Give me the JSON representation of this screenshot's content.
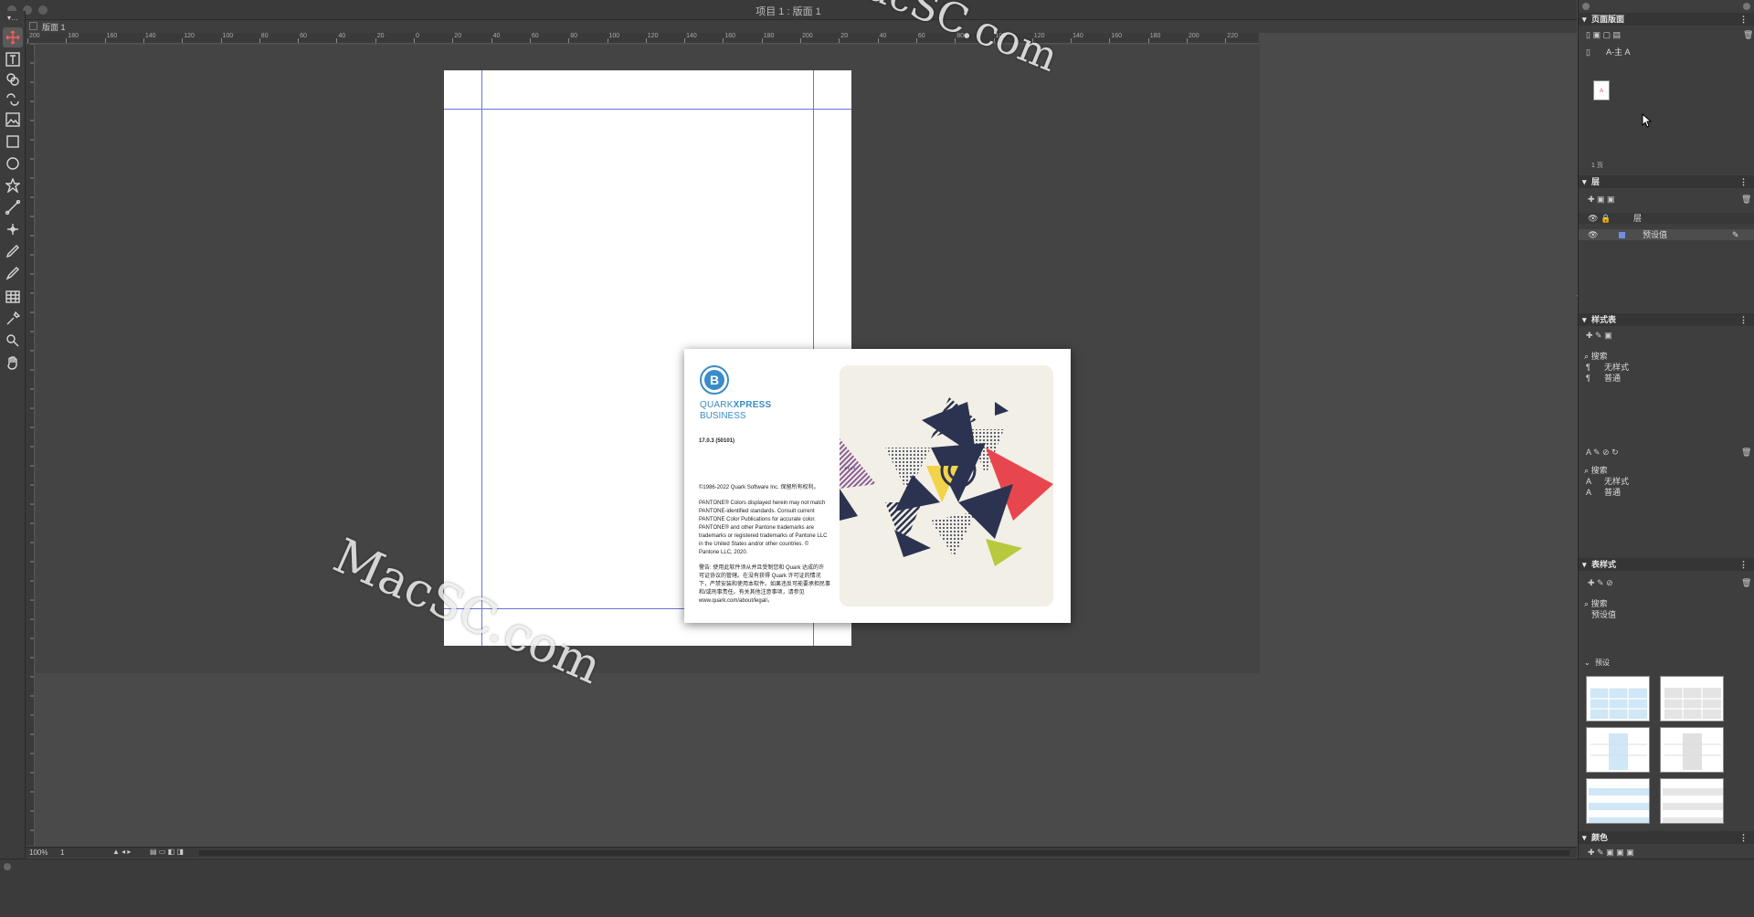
{
  "window": {
    "title": "项目 1 : 版面 1",
    "tab": "版面 1"
  },
  "toolbox": {
    "tools": [
      "move-tool",
      "text-tool",
      "text-linking-tool",
      "text-unlinking-tool",
      "picture-content-tool",
      "rectangle-box-tool",
      "oval-box-tool",
      "star-box-tool",
      "line-tool",
      "scissors-tool",
      "pen-tool",
      "freehand-tool",
      "table-tool",
      "eyedropper-tool",
      "zoom-tool",
      "pan-tool"
    ]
  },
  "ruler": {
    "h_labels": [
      "200",
      "180",
      "160",
      "140",
      "120",
      "100",
      "80",
      "60",
      "40",
      "20",
      "0",
      "20",
      "40",
      "60",
      "80",
      "100",
      "120",
      "140",
      "160",
      "180",
      "200",
      "20",
      "40",
      "60",
      "80",
      "100",
      "120",
      "140",
      "160",
      "180",
      "200",
      "220"
    ]
  },
  "splash": {
    "brand_line1": "QUARK",
    "brand_line1b": "XPRESS",
    "brand_line2": "BUSINESS",
    "version": "17.0.3 (50101)",
    "copyright": "©1986-2022 Quark Software Inc. 保留所有权利。",
    "pantone": "PANTONE® Colors displayed herein may not match\nPANTONE-identified standards. Consult current\nPANTONE Color Publications for accurate color.\nPANTONE® and other Pantone trademarks are\ntrademarks or registered trademarks of Pantone LLC\nin the United States and/or other countries. ©\nPantone LLC, 2020.",
    "warning": "警告: 使用此软件须从并且受制您和 Quark 达成的许\n可证协议的管辖。在没有获得 Quark 许可证的情况\n下，严禁安装和使用本软件。如果违反可能要承担民事\n和/或刑事责任。有关其他注意事项，请参见\nwww.quark.com/about/legal/。"
  },
  "statusbar": {
    "zoom": "100%",
    "page": "1"
  },
  "panel": {
    "page_layout": {
      "title": "页面版面",
      "master": "A-主 A",
      "page_count": "1 页",
      "thumb_label": "A"
    },
    "layers": {
      "title": "层",
      "header": "层",
      "layer_name": "预设值"
    },
    "style_sheets": {
      "title": "样式表",
      "search": "搜索",
      "para_items": [
        "无样式",
        "普通"
      ],
      "char_search": "搜索",
      "char_items": [
        "无样式",
        "普通"
      ]
    },
    "table_styles": {
      "title": "表样式",
      "search": "搜索",
      "item": "预设值",
      "preset_label": "预设"
    },
    "colors": {
      "title": "颜色"
    }
  },
  "watermark": {
    "text": "MacSC.com"
  },
  "colors": {
    "accent": "#e8464e",
    "guide": "#5b6bd6",
    "brand_blue": "#3a8cc8"
  }
}
